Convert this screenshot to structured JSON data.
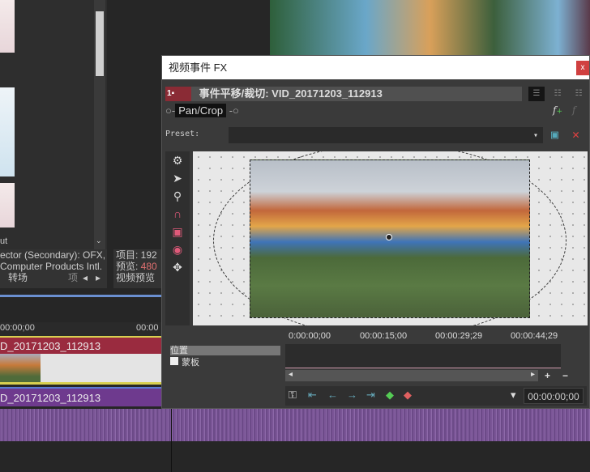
{
  "left_panel": {
    "partial_label": "ut",
    "info_line1": "ector (Secondary): OFX,",
    "info_line2": "Computer Products Intl.",
    "tab_transitions": "转场",
    "tab_partial": "项"
  },
  "mid_info": {
    "project_label": "项目: 192",
    "preview_label": "预览: ",
    "preview_value": "480",
    "tab_video_preview": "视频预览"
  },
  "timeline": {
    "ruler_start": "00:00;00",
    "ruler_next": "00:00",
    "video_track_name": "D_20171203_112913",
    "audio_track_name": "D_20171203_112913"
  },
  "dialog": {
    "title": "视频事件 FX",
    "close": "x",
    "chain_number": "1",
    "fx_header": "事件平移/裁切: VID_20171203_112913",
    "plugin_name": "Pan/Crop",
    "preset_label": "Preset:",
    "preset_value": "",
    "keyframes": {
      "rows": [
        "位置",
        "蒙板"
      ],
      "ruler": [
        "0:00:00;00",
        "00:00:15;00",
        "00:00:29;29",
        "00:00:44;29"
      ],
      "current_time": "00:00:00;00",
      "zoom_in": "+",
      "zoom_out": "−"
    }
  },
  "colors": {
    "accent_red": "#9a2b3f",
    "accent_purple": "#6e3a8e",
    "close_red": "#d04040"
  }
}
